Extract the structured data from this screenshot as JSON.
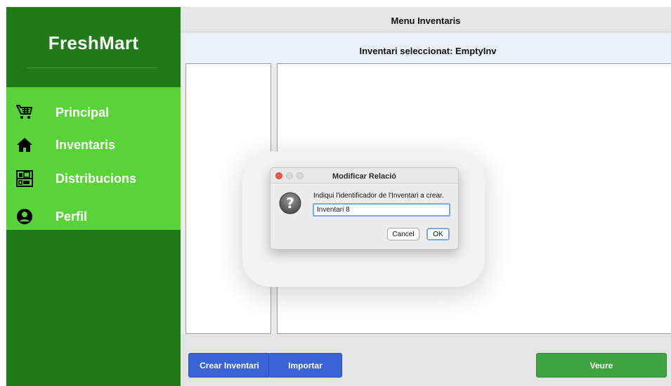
{
  "sidebar": {
    "brand": "FreshMart",
    "items": [
      {
        "label": "Principal",
        "icon": "cart-icon"
      },
      {
        "label": "Inventaris",
        "icon": "home-icon"
      },
      {
        "label": "Distribucions",
        "icon": "shelf-icon"
      },
      {
        "label": "Perfil",
        "icon": "user-icon"
      }
    ]
  },
  "main": {
    "window_title": "Menu Inventaris",
    "selected_inventory": "Inventari seleccionat: EmptyInv"
  },
  "toolbar": {
    "create_label": "Crear Inventari",
    "import_label": "Importar",
    "view_label": "Veure"
  },
  "dialog": {
    "title": "Modificar Relació",
    "prompt": "Indiqui l'identificador de l'Inventari a crear.",
    "input_value": "Inventari 8",
    "cancel_label": "Cancel",
    "ok_label": "OK"
  },
  "colors": {
    "sidebar_dark": "#1f7a17",
    "sidebar_light": "#5ad23a",
    "button_blue": "#3a63d6",
    "button_green": "#3fa241"
  }
}
